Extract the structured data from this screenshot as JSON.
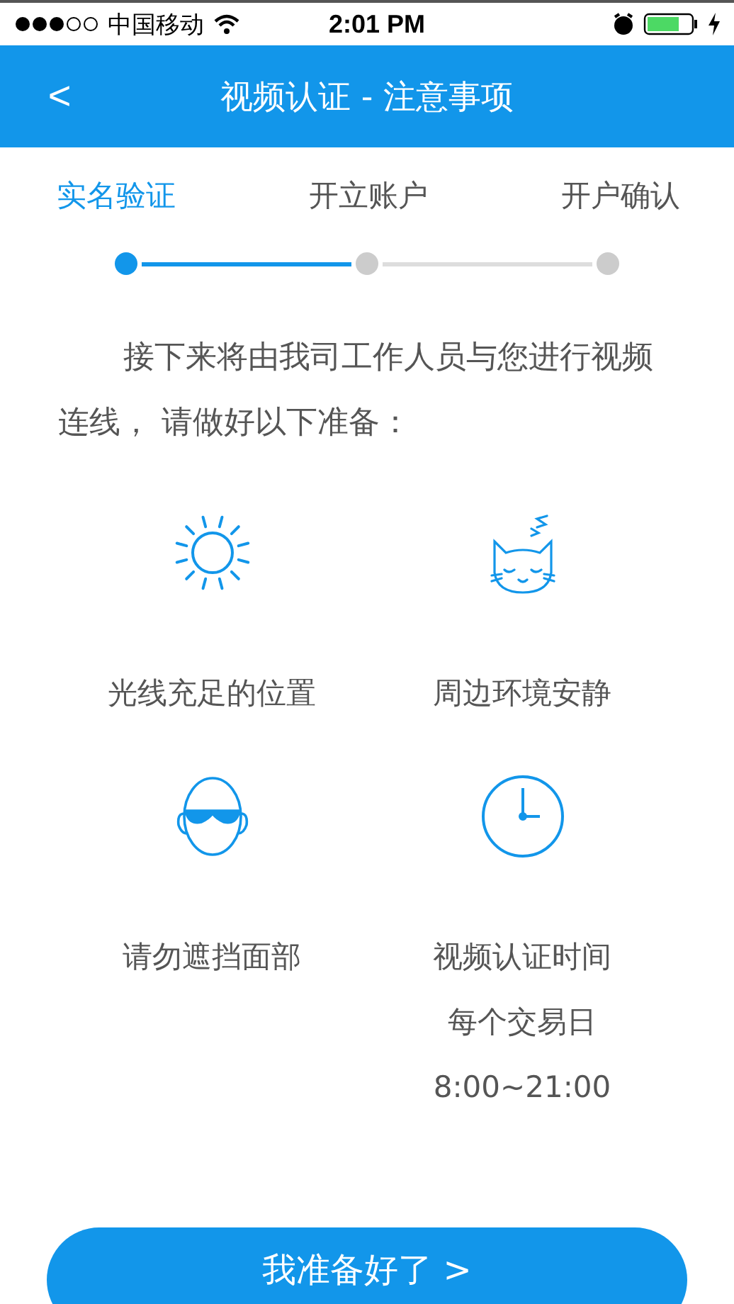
{
  "status_bar": {
    "carrier": "中国移动",
    "time": "2:01 PM"
  },
  "nav_bar": {
    "back": "<",
    "title": "视频认证 - 注意事项"
  },
  "steps": [
    {
      "label": "实名验证",
      "selected": true
    },
    {
      "label": "开立账户",
      "selected": false
    },
    {
      "label": "开户确认",
      "selected": false
    }
  ],
  "intro": "接下来将由我司工作人员与您进行视频连线， 请做好以下准备：",
  "tips": [
    {
      "kind": "sun",
      "lines": [
        "光线充足的位置"
      ]
    },
    {
      "kind": "cat",
      "lines": [
        "周边环境安静"
      ]
    },
    {
      "kind": "face",
      "lines": [
        "请勿遮挡面部"
      ]
    },
    {
      "kind": "clock",
      "lines": [
        "视频认证时间",
        "每个交易日",
        "8:00~21:00"
      ]
    }
  ],
  "button": {
    "label": "我准备好了 >"
  }
}
